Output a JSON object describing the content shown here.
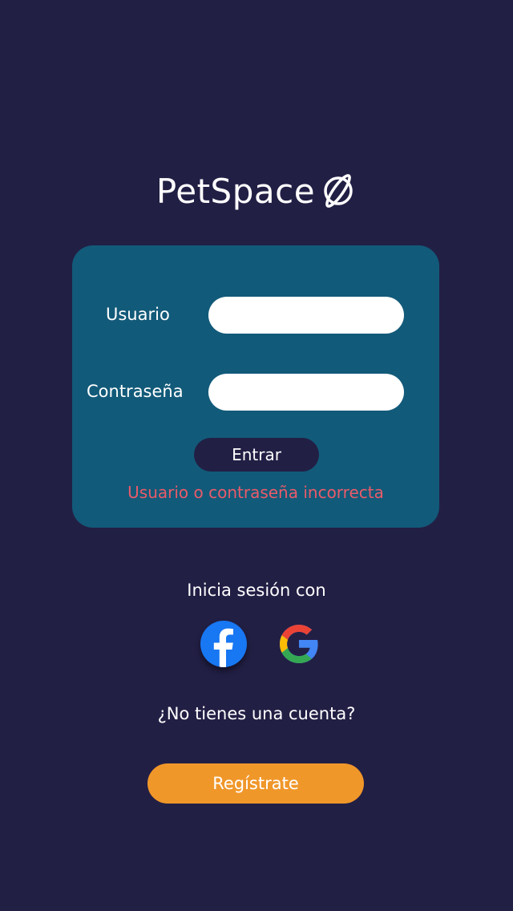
{
  "brand": {
    "name": "PetSpace",
    "icon": "planet-icon"
  },
  "login_form": {
    "username_label": "Usuario",
    "username_value": "",
    "password_label": "Contraseña",
    "password_value": "",
    "submit_label": "Entrar",
    "error_message": "Usuario o contraseña incorrecta"
  },
  "social_login": {
    "title": "Inicia sesión con",
    "providers": [
      {
        "icon": "facebook-icon"
      },
      {
        "icon": "google-icon"
      }
    ]
  },
  "register": {
    "prompt": "¿No tienes una cuenta?",
    "button_label": "Regístrate"
  },
  "colors": {
    "background": "#221f45",
    "card": "#125a79",
    "error": "#ea5b6a",
    "accent": "#f0972a"
  }
}
